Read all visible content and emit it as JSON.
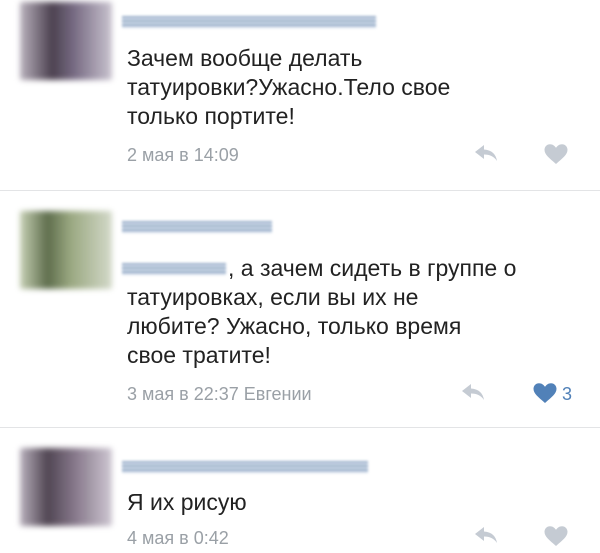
{
  "comments": [
    {
      "text": "Зачем вообще делать\nтатуировки?Ужасно.Тело свое\nтолько портите!",
      "date": "2 мая в 14:09",
      "reply_icon": "reply-arrow-icon",
      "like_icon": "heart-icon",
      "liked": false
    },
    {
      "reply_text": ", а зачем сидеть в группе о",
      "text": "татуировках, если вы их не\nлюбите? Ужасно, только время\nсвое тратите!",
      "date": "3 мая в 22:37 Евгении",
      "reply_icon": "reply-arrow-icon",
      "like_icon": "heart-icon",
      "liked": true,
      "likes": "3"
    },
    {
      "text": "Я их рисую",
      "date": "4 мая в 0:42",
      "reply_icon": "reply-arrow-icon",
      "like_icon": "heart-icon",
      "liked": false
    }
  ],
  "colors": {
    "text": "#222222",
    "meta": "#9aa0a6",
    "like_active": "#5181b8",
    "icon_inactive": "#c5cbd3",
    "divider": "#e3e4e6"
  }
}
